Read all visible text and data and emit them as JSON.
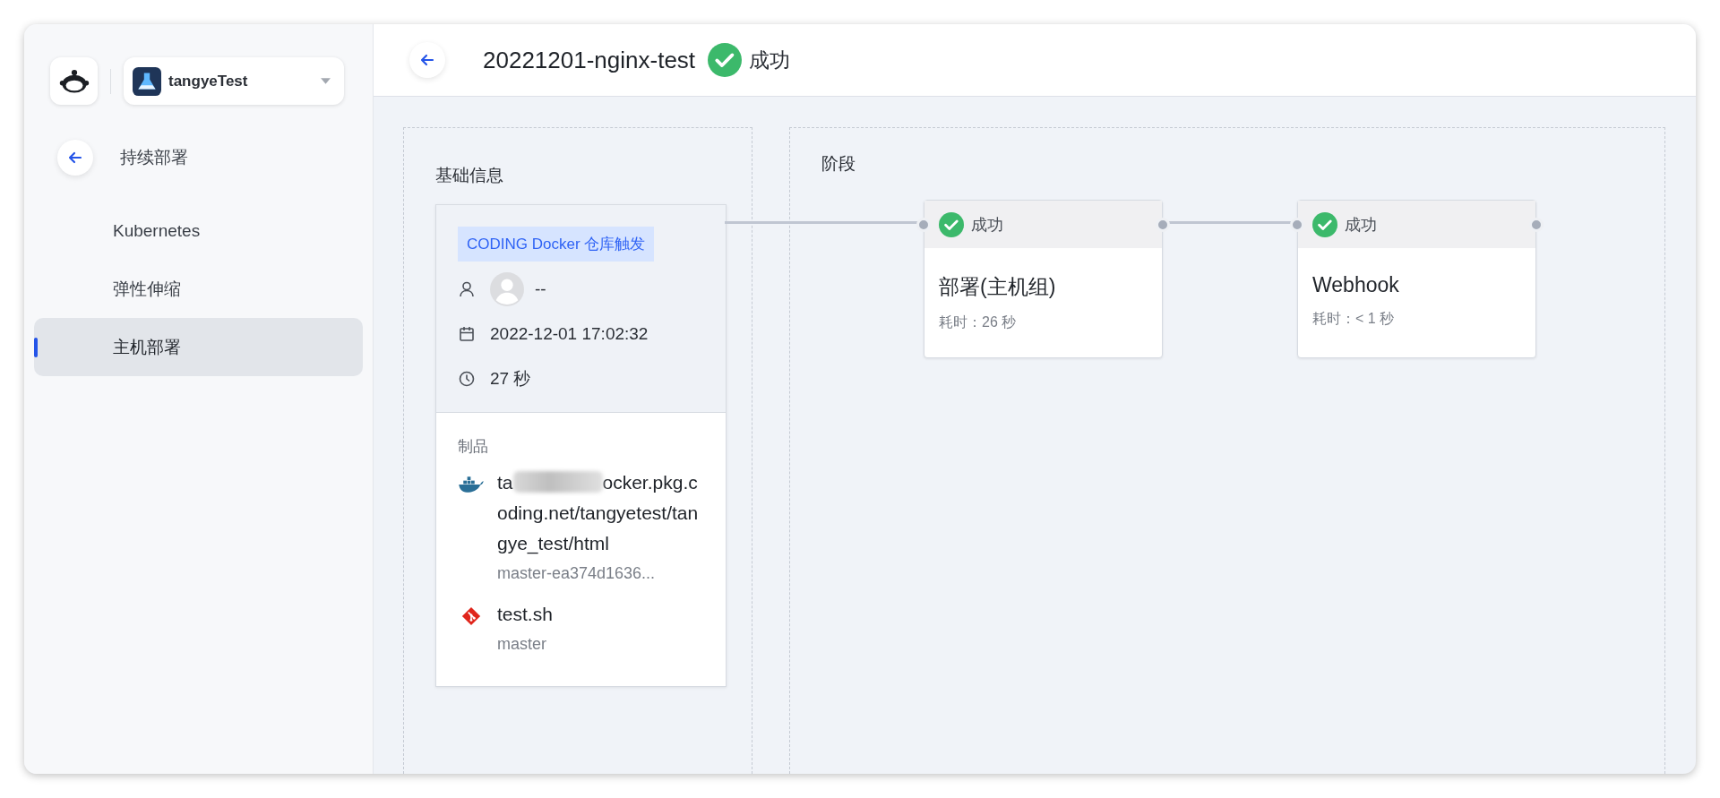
{
  "sidebar": {
    "project": {
      "name": "tangyeTest"
    },
    "back_label": "持续部署",
    "items": [
      {
        "label": "Kubernetes",
        "selected": false
      },
      {
        "label": "弹性伸缩",
        "selected": false
      },
      {
        "label": "主机部署",
        "selected": true
      }
    ]
  },
  "header": {
    "title": "20221201-nginx-test",
    "status": {
      "kind": "success",
      "label": "成功"
    }
  },
  "info": {
    "title": "基础信息",
    "trigger": "CODING Docker 仓库触发",
    "user": "--",
    "time": "2022-12-01 17:02:32",
    "duration": "27 秒",
    "artifacts_title": "制品",
    "artifacts": [
      {
        "kind": "docker",
        "visible_start": "ta",
        "redacted": true,
        "name": "ocker.pkg.coding.net/tangyetest/tangye_test/html",
        "version": "master-ea374d1636..."
      },
      {
        "kind": "git",
        "name": "test.sh",
        "version": "master"
      }
    ]
  },
  "stages": {
    "title": "阶段",
    "items": [
      {
        "status": {
          "kind": "success",
          "label": "成功"
        },
        "name": "部署(主机组)",
        "duration": "耗时：26 秒"
      },
      {
        "status": {
          "kind": "success",
          "label": "成功"
        },
        "name": "Webhook",
        "duration": "耗时：< 1 秒"
      }
    ]
  }
}
